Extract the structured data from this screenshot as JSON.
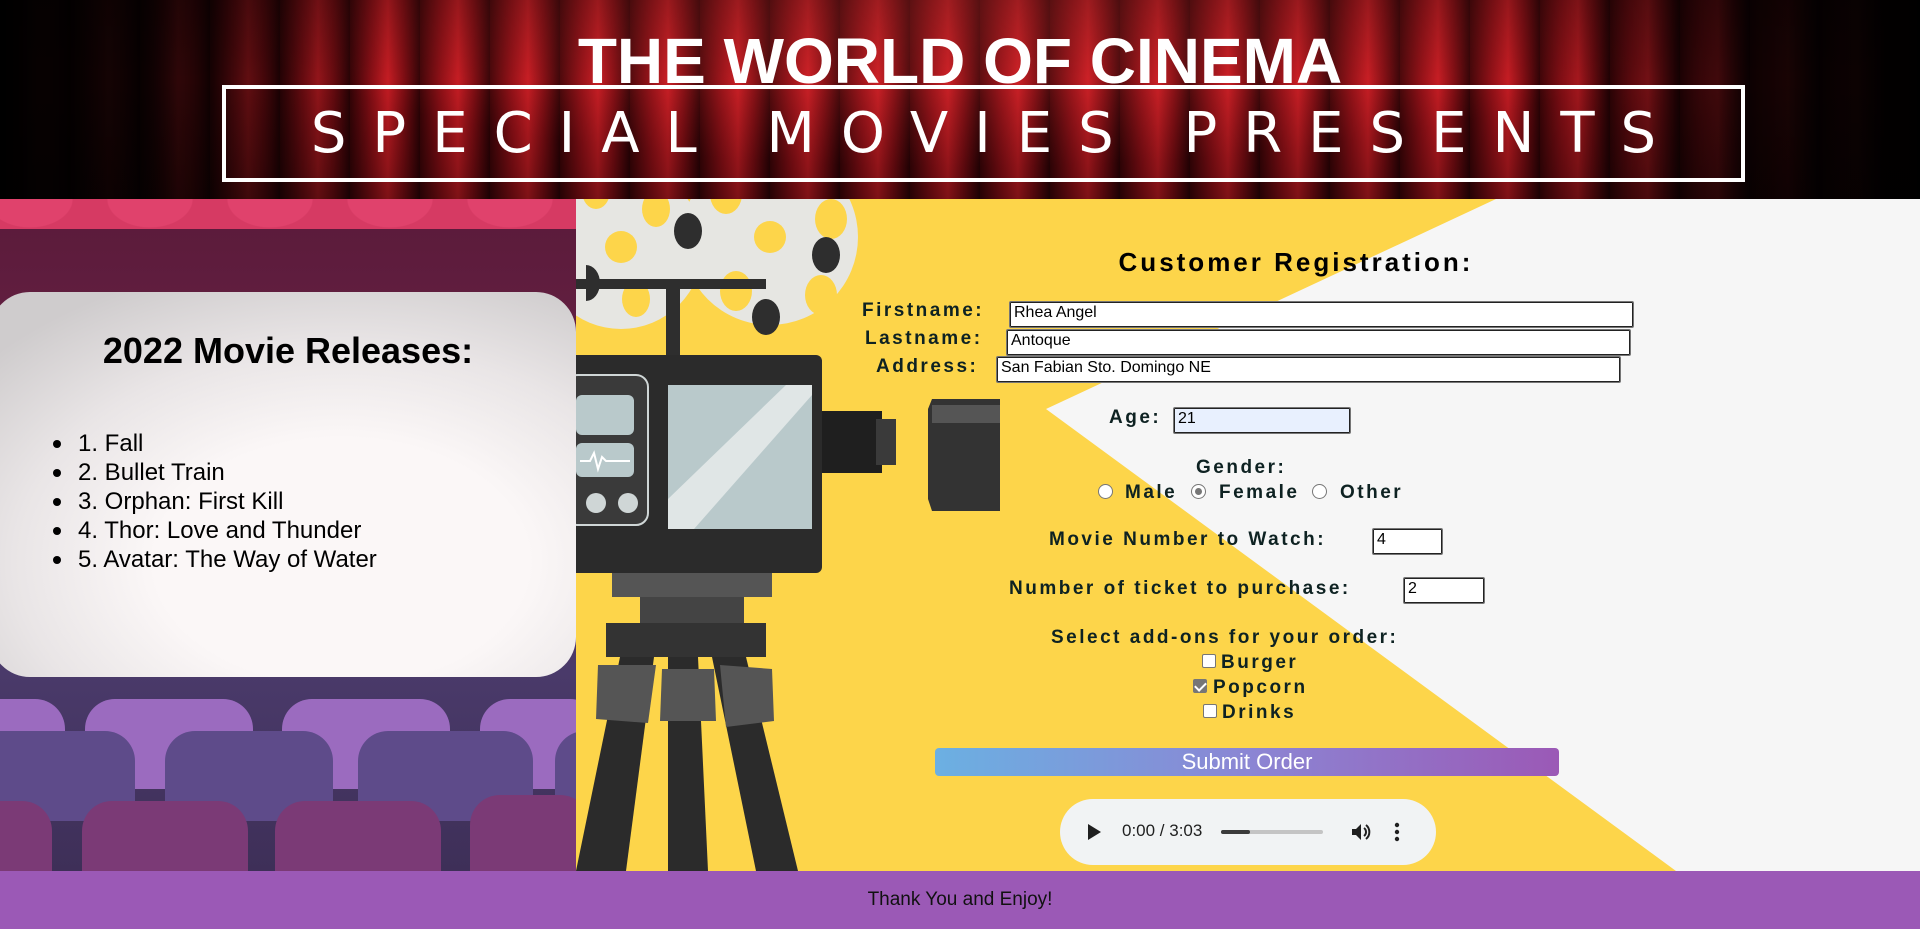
{
  "header": {
    "title": "THE WORLD OF CINEMA",
    "banner": "SPECIAL MOVIES PRESENTS"
  },
  "releases": {
    "title": "2022 Movie Releases:",
    "items": [
      "1. Fall",
      "2. Bullet Train",
      "3. Orphan: First Kill",
      "4. Thor: Love and Thunder",
      "5. Avatar: The Way of Water"
    ]
  },
  "form": {
    "title": "Customer Registration:",
    "firstname": {
      "label": "Firstname:",
      "value": "Rhea Angel"
    },
    "lastname": {
      "label": "Lastname:",
      "value": "Antoque"
    },
    "address": {
      "label": "Address:",
      "value": "San Fabian Sto. Domingo NE"
    },
    "age": {
      "label": "Age:",
      "value": "21"
    },
    "gender": {
      "label": "Gender:",
      "options": [
        "Male",
        "Female",
        "Other"
      ],
      "selected": "Female"
    },
    "movie_number": {
      "label": "Movie Number to Watch:",
      "value": "4"
    },
    "tickets": {
      "label": "Number of ticket to purchase:",
      "value": "2"
    },
    "addons": {
      "label": "Select add-ons for your order:",
      "options": [
        {
          "label": "Burger",
          "checked": false
        },
        {
          "label": "Popcorn",
          "checked": true
        },
        {
          "label": "Drinks",
          "checked": false
        }
      ]
    },
    "submit_label": "Submit Order"
  },
  "audio": {
    "time": "0:00 / 3:03",
    "progress": 0.28,
    "icons": [
      "play-icon",
      "volume-icon",
      "more-vert-icon"
    ]
  },
  "footer": {
    "text": "Thank You and Enjoy!"
  },
  "colors": {
    "accent_purple": "#9b59b6",
    "yellow": "#fdd54a",
    "curtain_red": "#b3141c"
  }
}
